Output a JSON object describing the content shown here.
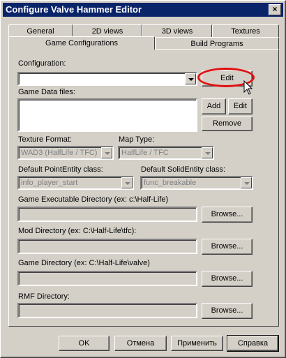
{
  "window": {
    "title": "Configure Valve Hammer Editor",
    "close": "×"
  },
  "tabs": {
    "row1": [
      "General",
      "2D views",
      "3D views",
      "Textures"
    ],
    "row2": [
      "Game Configurations",
      "Build Programs"
    ]
  },
  "config": {
    "label": "Configuration:",
    "value": "",
    "edit": "Edit"
  },
  "gamedata": {
    "label": "Game Data files:",
    "add": "Add",
    "edit": "Edit",
    "remove": "Remove"
  },
  "texture": {
    "label": "Texture Format:",
    "value": "WAD3 (HalfLife / TFC)"
  },
  "maptype": {
    "label": "Map Type:",
    "value": "HalfLife / TFC"
  },
  "point": {
    "label": "Default PointEntity class:",
    "value": "info_player_start"
  },
  "solid": {
    "label": "Default SolidEntity class:",
    "value": "func_breakable"
  },
  "dirs": [
    {
      "label": "Game Executable Directory (ex: c:\\Half-Life)",
      "browse": "Browse..."
    },
    {
      "label": "Mod Directory (ex: C:\\Half-Life\\tfc):",
      "browse": "Browse..."
    },
    {
      "label": "Game Directory (ex: C:\\Half-Life\\valve)",
      "browse": "Browse..."
    },
    {
      "label": "RMF Directory:",
      "browse": "Browse..."
    }
  ],
  "footer": {
    "ok": "OK",
    "cancel": "Отмена",
    "apply": "Применить",
    "help": "Справка"
  }
}
